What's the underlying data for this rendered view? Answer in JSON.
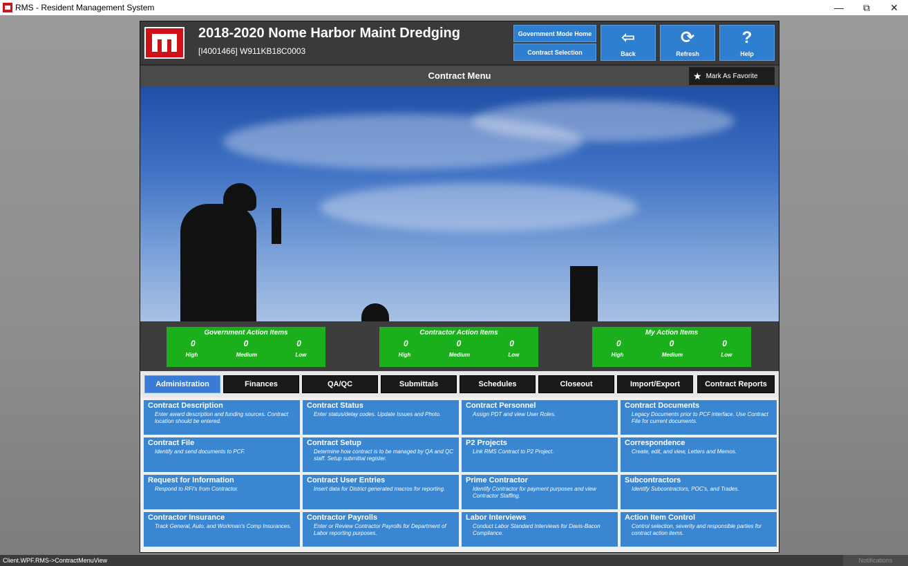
{
  "window": {
    "title": "RMS - Resident Management System",
    "controls": [
      "—",
      "⧉",
      "✕"
    ]
  },
  "header": {
    "title": "2018-2020 Nome Harbor Maint Dredging",
    "subtitle": "[I4001466] W911KB18C0003",
    "nav_gov_home": "Government Mode Home",
    "nav_contract_selection": "Contract Selection",
    "back_label": "Back",
    "refresh_label": "Refresh",
    "help_label": "Help"
  },
  "menubar": {
    "title": "Contract Menu",
    "favorite_label": "Mark As Favorite"
  },
  "action_items": [
    {
      "title": "Government Action Items",
      "high": "0",
      "medium": "0",
      "low": "0",
      "labels": [
        "High",
        "Medium",
        "Low"
      ]
    },
    {
      "title": "Contractor Action Items",
      "high": "0",
      "medium": "0",
      "low": "0",
      "labels": [
        "High",
        "Medium",
        "Low"
      ]
    },
    {
      "title": "My Action Items",
      "high": "0",
      "medium": "0",
      "low": "0",
      "labels": [
        "High",
        "Medium",
        "Low"
      ]
    }
  ],
  "tabs": [
    {
      "label": "Administration",
      "active": true
    },
    {
      "label": "Finances"
    },
    {
      "label": "QA/QC"
    },
    {
      "label": "Submittals"
    },
    {
      "label": "Schedules"
    },
    {
      "label": "Closeout"
    },
    {
      "label": "Import/Export"
    },
    {
      "label": "Contract Reports"
    }
  ],
  "tiles": [
    {
      "title": "Contract Description",
      "desc": "Enter award description and funding sources. Contract location should be entered."
    },
    {
      "title": "Contract Status",
      "desc": "Enter status/delay codes. Update Issues and Photo."
    },
    {
      "title": "Contract Personnel",
      "desc": "Assign PDT and view User Roles."
    },
    {
      "title": "Contract Documents",
      "desc": "Legacy Documents prior to PCF interface. Use Contract File for current documents."
    },
    {
      "title": "Contract File",
      "desc": "Identify and send documents to PCF."
    },
    {
      "title": "Contract Setup",
      "desc": "Determine how contract is to be managed by QA and QC staff. Setup submittal register."
    },
    {
      "title": "P2 Projects",
      "desc": "Link RMS Contract to P2 Project."
    },
    {
      "title": "Correspondence",
      "desc": "Create, edit, and view, Letters and Memos."
    },
    {
      "title": "Request for Information",
      "desc": "Respond to RFI's from Contractor."
    },
    {
      "title": "Contract User Entries",
      "desc": "Insert data for District generated macros for reporting."
    },
    {
      "title": "Prime Contractor",
      "desc": "Identify Contractor for payment purposes and view Contractor Staffing."
    },
    {
      "title": "Subcontractors",
      "desc": "Identify Subcontractors, POC's, and Trades."
    },
    {
      "title": "Contractor Insurance",
      "desc": "Track General, Auto, and Workman's Comp Insurances."
    },
    {
      "title": "Contractor Payrolls",
      "desc": "Enter or Review Contractor Payrolls for Department of Labor reporting purposes."
    },
    {
      "title": "Labor Interviews",
      "desc": "Conduct Labor Standard Interviews for Davis-Bacon Compliance."
    },
    {
      "title": "Action Item Control",
      "desc": "Control selection, severity and responsible parties for contract action items."
    }
  ],
  "status": {
    "left": "Client.WPF.RMS->ContractMenuView",
    "notifications": "Notifications"
  },
  "icons": {
    "back": "arrow-left-icon",
    "refresh": "refresh-icon",
    "help": "help-icon",
    "favorite": "star-icon"
  },
  "colors": {
    "accent": "#3a86d1",
    "action_green": "#1caf1c",
    "brand_red": "#d01018"
  }
}
